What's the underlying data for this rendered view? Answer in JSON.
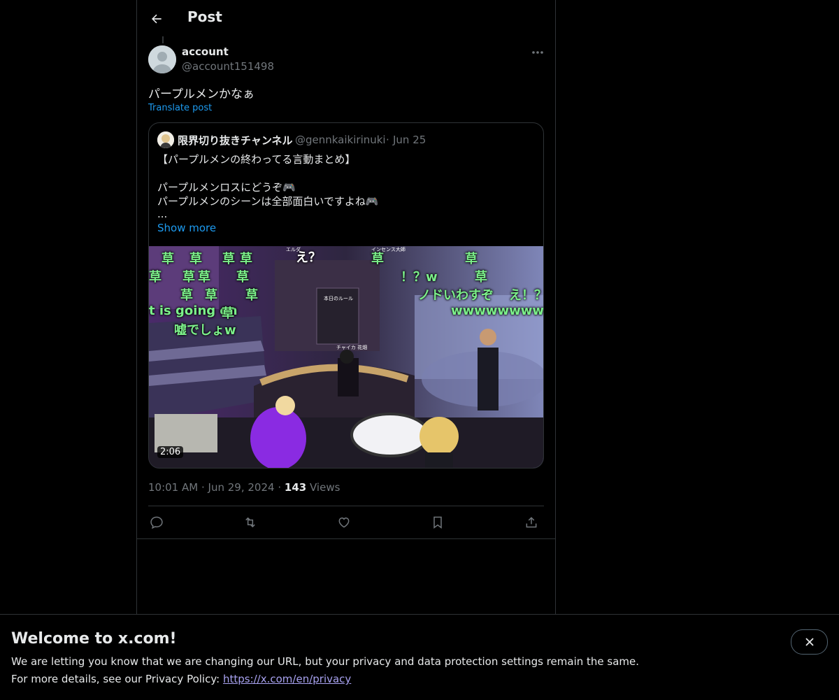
{
  "header": {
    "title": "Post"
  },
  "post": {
    "author_name": "account",
    "author_handle": "@account151498",
    "text": "パープルメンかなぁ",
    "translate_label": "Translate post",
    "time": "10:01 AM",
    "date": "Jun 29, 2024",
    "separator": "·",
    "views_count": "143",
    "views_label": "Views"
  },
  "quote": {
    "author_name": "限界切り抜きチャンネル",
    "author_handle": "@gennkaikirinuki",
    "separator": "·",
    "date": "Jun 25",
    "lines": [
      "【パープルメンの終わってる言動まとめ】",
      "パープルメンロスにどうぞ🎮",
      "パープルメンのシーンは全部面白いですよね🎮",
      "..."
    ],
    "show_more": "Show more",
    "video": {
      "duration": "2:06",
      "overlay_texts": [
        "草",
        "草",
        "草",
        "草",
        "え？",
        "草",
        "草",
        "草",
        "草",
        "草",
        "草",
        "草",
        "草",
        "草",
        "！？w",
        "草",
        "ノドいわすぞ",
        "え！？",
        "wwwwwwww",
        "t is going on",
        "草",
        "嘘でしょw"
      ],
      "overlay_small_texts": [
        "チャイカ 花畑",
        "エルダ",
        "インセンス大師",
        "本日のルール"
      ]
    }
  },
  "actions": {
    "reply": "reply-icon",
    "repost": "repost-icon",
    "like": "heart-icon",
    "bookmark": "bookmark-icon",
    "share": "share-icon"
  },
  "banner": {
    "title": "Welcome to x.com!",
    "line1": "We are letting you know that we are changing our URL, but your privacy and data protection settings remain the same.",
    "line2_prefix": "For more details, see our Privacy Policy:",
    "link": "https://x.com/en/privacy"
  },
  "colors": {
    "background": "#000000",
    "text": "#e7e9ea",
    "muted": "#71767b",
    "accent": "#1d9bf0",
    "border": "#2f3336",
    "link_visited": "#a8a2f0"
  }
}
